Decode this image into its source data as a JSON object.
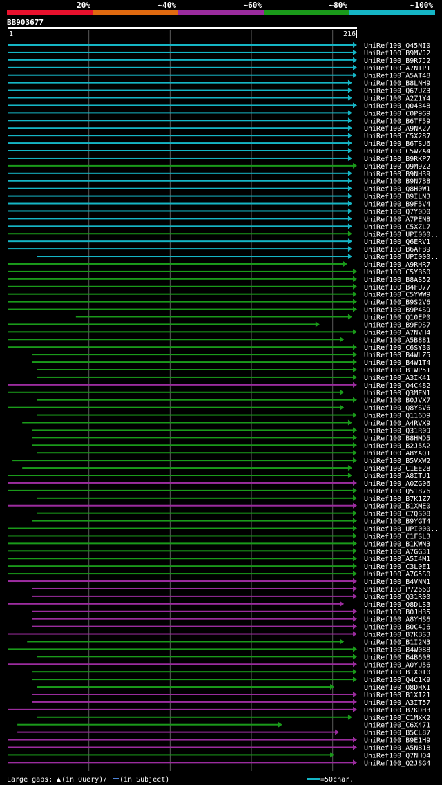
{
  "chart_data": {
    "type": "alignment-overview",
    "query_id": "BB903677",
    "query_start": "1",
    "query_end": "216",
    "identity_legend": [
      {
        "label": "20%",
        "color": "#e8112d"
      },
      {
        "label": "~40%",
        "color": "#e06a10"
      },
      {
        "label": "~60%",
        "color": "#9b2c9e"
      },
      {
        "label": "~80%",
        "color": "#1a9a1a"
      },
      {
        "label": "~100%",
        "color": "#15b5c5"
      }
    ],
    "footer": {
      "gaps_label": "Large gaps:",
      "query_gap_text": "(in Query)/",
      "subject_gap_text": "(in Subject)",
      "scale_text": "=50char."
    },
    "hits": [
      {
        "label": "UniRef100_Q45NI0",
        "start": 1,
        "end": 216,
        "tier": 4
      },
      {
        "label": "UniRef100_B9MVJ2",
        "start": 1,
        "end": 216,
        "tier": 4
      },
      {
        "label": "UniRef100_B9R7J2",
        "start": 1,
        "end": 216,
        "tier": 4
      },
      {
        "label": "UniRef100_A7NTP1",
        "start": 1,
        "end": 216,
        "tier": 4
      },
      {
        "label": "UniRef100_A5AT48",
        "start": 1,
        "end": 216,
        "tier": 4
      },
      {
        "label": "UniRef100_B8LNH9",
        "start": 1,
        "end": 213,
        "tier": 4
      },
      {
        "label": "UniRef100_Q67UZ3",
        "start": 1,
        "end": 213,
        "tier": 4
      },
      {
        "label": "UniRef100_A2Z1Y4",
        "start": 1,
        "end": 213,
        "tier": 4
      },
      {
        "label": "UniRef100_Q04348",
        "start": 1,
        "end": 216,
        "tier": 4
      },
      {
        "label": "UniRef100_C0P9G9",
        "start": 1,
        "end": 213,
        "tier": 4
      },
      {
        "label": "UniRef100_B6TF59",
        "start": 1,
        "end": 213,
        "tier": 4
      },
      {
        "label": "UniRef100_A9NK27",
        "start": 1,
        "end": 213,
        "tier": 4
      },
      {
        "label": "UniRef100_C5X287",
        "start": 1,
        "end": 213,
        "tier": 4
      },
      {
        "label": "UniRef100_B6TSU6",
        "start": 1,
        "end": 213,
        "tier": 4
      },
      {
        "label": "UniRef100_C5WZA4",
        "start": 1,
        "end": 213,
        "tier": 4
      },
      {
        "label": "UniRef100_B9RKP7",
        "start": 1,
        "end": 213,
        "tier": 4
      },
      {
        "label": "UniRef100_Q9M9Z2",
        "start": 1,
        "end": 216,
        "tier": 3
      },
      {
        "label": "UniRef100_B9NH39",
        "start": 1,
        "end": 213,
        "tier": 4
      },
      {
        "label": "UniRef100_B9N7B8",
        "start": 1,
        "end": 213,
        "tier": 4
      },
      {
        "label": "UniRef100_Q8H0W1",
        "start": 1,
        "end": 213,
        "tier": 4
      },
      {
        "label": "UniRef100_B9ILN3",
        "start": 1,
        "end": 213,
        "tier": 4
      },
      {
        "label": "UniRef100_B9F5V4",
        "start": 1,
        "end": 213,
        "tier": 4
      },
      {
        "label": "UniRef100_Q7Y0D0",
        "start": 1,
        "end": 213,
        "tier": 4
      },
      {
        "label": "UniRef100_A7PEN8",
        "start": 1,
        "end": 213,
        "tier": 4
      },
      {
        "label": "UniRef100_C5XZL7",
        "start": 1,
        "end": 213,
        "tier": 4
      },
      {
        "label": "UniRef100_UPI000..",
        "start": 1,
        "end": 213,
        "tier": 3
      },
      {
        "label": "UniRef100_Q6ERV1",
        "start": 1,
        "end": 213,
        "tier": 4
      },
      {
        "label": "UniRef100_B6AFB9",
        "start": 1,
        "end": 213,
        "tier": 4
      },
      {
        "label": "UniRef100_UPI000..",
        "start": 19,
        "end": 213,
        "tier": 4
      },
      {
        "label": "UniRef100_A9RHR7",
        "start": 1,
        "end": 210,
        "tier": 3
      },
      {
        "label": "UniRef100_C5YB60",
        "start": 1,
        "end": 216,
        "tier": 3
      },
      {
        "label": "UniRef100_B8AS52",
        "start": 1,
        "end": 216,
        "tier": 3
      },
      {
        "label": "UniRef100_B4FU77",
        "start": 1,
        "end": 216,
        "tier": 3
      },
      {
        "label": "UniRef100_C5YWW9",
        "start": 1,
        "end": 216,
        "tier": 3
      },
      {
        "label": "UniRef100_B9S2V6",
        "start": 1,
        "end": 216,
        "tier": 3
      },
      {
        "label": "UniRef100_B9P4S9",
        "start": 1,
        "end": 216,
        "tier": 3
      },
      {
        "label": "UniRef100_Q10EP0",
        "start": 43,
        "end": 213,
        "tier": 3
      },
      {
        "label": "UniRef100_B9FDS7",
        "start": 1,
        "end": 193,
        "tier": 3
      },
      {
        "label": "UniRef100_A7NVH4",
        "start": 1,
        "end": 216,
        "tier": 3
      },
      {
        "label": "UniRef100_A5B881",
        "start": 1,
        "end": 208,
        "tier": 3
      },
      {
        "label": "UniRef100_C6SY30",
        "start": 1,
        "end": 216,
        "tier": 3
      },
      {
        "label": "UniRef100_B4WLZ5",
        "start": 16,
        "end": 216,
        "tier": 3
      },
      {
        "label": "UniRef100_B4W1T4",
        "start": 16,
        "end": 216,
        "tier": 3
      },
      {
        "label": "UniRef100_B1WP51",
        "start": 19,
        "end": 216,
        "tier": 3
      },
      {
        "label": "UniRef100_A3IK41",
        "start": 19,
        "end": 216,
        "tier": 3
      },
      {
        "label": "UniRef100_Q4C482",
        "start": 1,
        "end": 216,
        "tier": 2
      },
      {
        "label": "UniRef100_Q3MEN1",
        "start": 1,
        "end": 208,
        "tier": 3
      },
      {
        "label": "UniRef100_B0JVX7",
        "start": 19,
        "end": 216,
        "tier": 3
      },
      {
        "label": "UniRef100_Q8YSV6",
        "start": 1,
        "end": 208,
        "tier": 3
      },
      {
        "label": "UniRef100_Q116D9",
        "start": 19,
        "end": 216,
        "tier": 3
      },
      {
        "label": "UniRef100_A4RVX9",
        "start": 10,
        "end": 213,
        "tier": 3
      },
      {
        "label": "UniRef100_Q31R09",
        "start": 16,
        "end": 216,
        "tier": 3
      },
      {
        "label": "UniRef100_B8HMD5",
        "start": 16,
        "end": 216,
        "tier": 3
      },
      {
        "label": "UniRef100_B2J5A2",
        "start": 16,
        "end": 216,
        "tier": 3
      },
      {
        "label": "UniRef100_A8YAQ1",
        "start": 19,
        "end": 216,
        "tier": 3
      },
      {
        "label": "UniRef100_B5VXW2",
        "start": 4,
        "end": 216,
        "tier": 3
      },
      {
        "label": "UniRef100_C1EE28",
        "start": 10,
        "end": 213,
        "tier": 3
      },
      {
        "label": "UniRef100_A8ITU1",
        "start": 1,
        "end": 213,
        "tier": 3
      },
      {
        "label": "UniRef100_A0ZG06",
        "start": 1,
        "end": 216,
        "tier": 2
      },
      {
        "label": "UniRef100_Q51876",
        "start": 1,
        "end": 216,
        "tier": 3
      },
      {
        "label": "UniRef100_B7K1Z7",
        "start": 19,
        "end": 216,
        "tier": 3
      },
      {
        "label": "UniRef100_B1XME0",
        "start": 1,
        "end": 216,
        "tier": 2
      },
      {
        "label": "UniRef100_C7QS08",
        "start": 19,
        "end": 216,
        "tier": 3
      },
      {
        "label": "UniRef100_B9YGT4",
        "start": 16,
        "end": 216,
        "tier": 3
      },
      {
        "label": "UniRef100_UPI000..",
        "start": 1,
        "end": 216,
        "tier": 3
      },
      {
        "label": "UniRef100_C1FSL3",
        "start": 1,
        "end": 216,
        "tier": 3
      },
      {
        "label": "UniRef100_B1KWN3",
        "start": 1,
        "end": 216,
        "tier": 3
      },
      {
        "label": "UniRef100_A7GG31",
        "start": 1,
        "end": 216,
        "tier": 3
      },
      {
        "label": "UniRef100_A5I4M1",
        "start": 1,
        "end": 216,
        "tier": 3
      },
      {
        "label": "UniRef100_C3L0E1",
        "start": 1,
        "end": 216,
        "tier": 3
      },
      {
        "label": "UniRef100_A7G5S0",
        "start": 1,
        "end": 216,
        "tier": 3
      },
      {
        "label": "UniRef100_B4VNN1",
        "start": 1,
        "end": 216,
        "tier": 2
      },
      {
        "label": "UniRef100_P72660",
        "start": 16,
        "end": 216,
        "tier": 2
      },
      {
        "label": "UniRef100_Q31R00",
        "start": 16,
        "end": 216,
        "tier": 2
      },
      {
        "label": "UniRef100_Q8DLS3",
        "start": 1,
        "end": 208,
        "tier": 2
      },
      {
        "label": "UniRef100_B0JH35",
        "start": 16,
        "end": 216,
        "tier": 2
      },
      {
        "label": "UniRef100_A8YHS6",
        "start": 16,
        "end": 216,
        "tier": 2
      },
      {
        "label": "UniRef100_B0C4J6",
        "start": 16,
        "end": 216,
        "tier": 2
      },
      {
        "label": "UniRef100_B7KBS3",
        "start": 1,
        "end": 216,
        "tier": 2
      },
      {
        "label": "UniRef100_B1I2N3",
        "start": 13,
        "end": 208,
        "tier": 3
      },
      {
        "label": "UniRef100_B4W088",
        "start": 1,
        "end": 216,
        "tier": 3
      },
      {
        "label": "UniRef100_B4B608",
        "start": 19,
        "end": 216,
        "tier": 3
      },
      {
        "label": "UniRef100_A0YU56",
        "start": 1,
        "end": 216,
        "tier": 2
      },
      {
        "label": "UniRef100_B1X0T0",
        "start": 16,
        "end": 216,
        "tier": 3
      },
      {
        "label": "UniRef100_Q4C1K9",
        "start": 16,
        "end": 216,
        "tier": 3
      },
      {
        "label": "UniRef100_Q8DHX1",
        "start": 19,
        "end": 202,
        "tier": 3
      },
      {
        "label": "UniRef100_B1XI21",
        "start": 16,
        "end": 216,
        "tier": 2
      },
      {
        "label": "UniRef100_A3IT57",
        "start": 16,
        "end": 216,
        "tier": 2
      },
      {
        "label": "UniRef100_B7KDH3",
        "start": 1,
        "end": 216,
        "tier": 2
      },
      {
        "label": "UniRef100_C1MXK2",
        "start": 19,
        "end": 213,
        "tier": 3
      },
      {
        "label": "UniRef100_C6X471",
        "start": 7,
        "end": 170,
        "tier": 3
      },
      {
        "label": "UniRef100_B5CL87",
        "start": 7,
        "end": 205,
        "tier": 2
      },
      {
        "label": "UniRef100_B9E1H9",
        "start": 1,
        "end": 216,
        "tier": 2
      },
      {
        "label": "UniRef100_A5N818",
        "start": 1,
        "end": 216,
        "tier": 2
      },
      {
        "label": "UniRef100_Q7NHQ4",
        "start": 1,
        "end": 202,
        "tier": 3
      },
      {
        "label": "UniRef100_Q2JSG4",
        "start": 1,
        "end": 216,
        "tier": 2
      }
    ]
  }
}
